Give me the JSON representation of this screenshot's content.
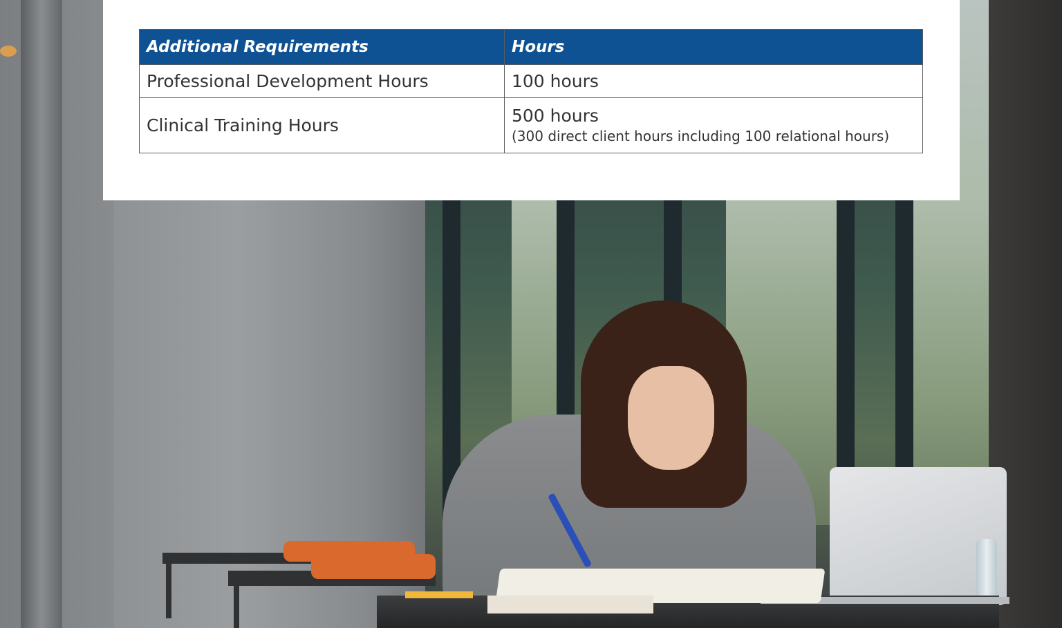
{
  "table": {
    "headers": [
      "Additional Requirements",
      "Hours"
    ],
    "rows": [
      {
        "requirement": "Professional Development Hours",
        "hours": "100 hours",
        "note": ""
      },
      {
        "requirement": "Clinical Training Hours",
        "hours": "500 hours",
        "note": "(300 direct client hours including 100 relational hours)"
      }
    ]
  },
  "colors": {
    "header_bg": "#0f5293",
    "header_text": "#ffffff",
    "body_text": "#333333",
    "border": "#5a5a5a"
  },
  "photo": {
    "subject": "student writing in notebook at table with laptop"
  }
}
